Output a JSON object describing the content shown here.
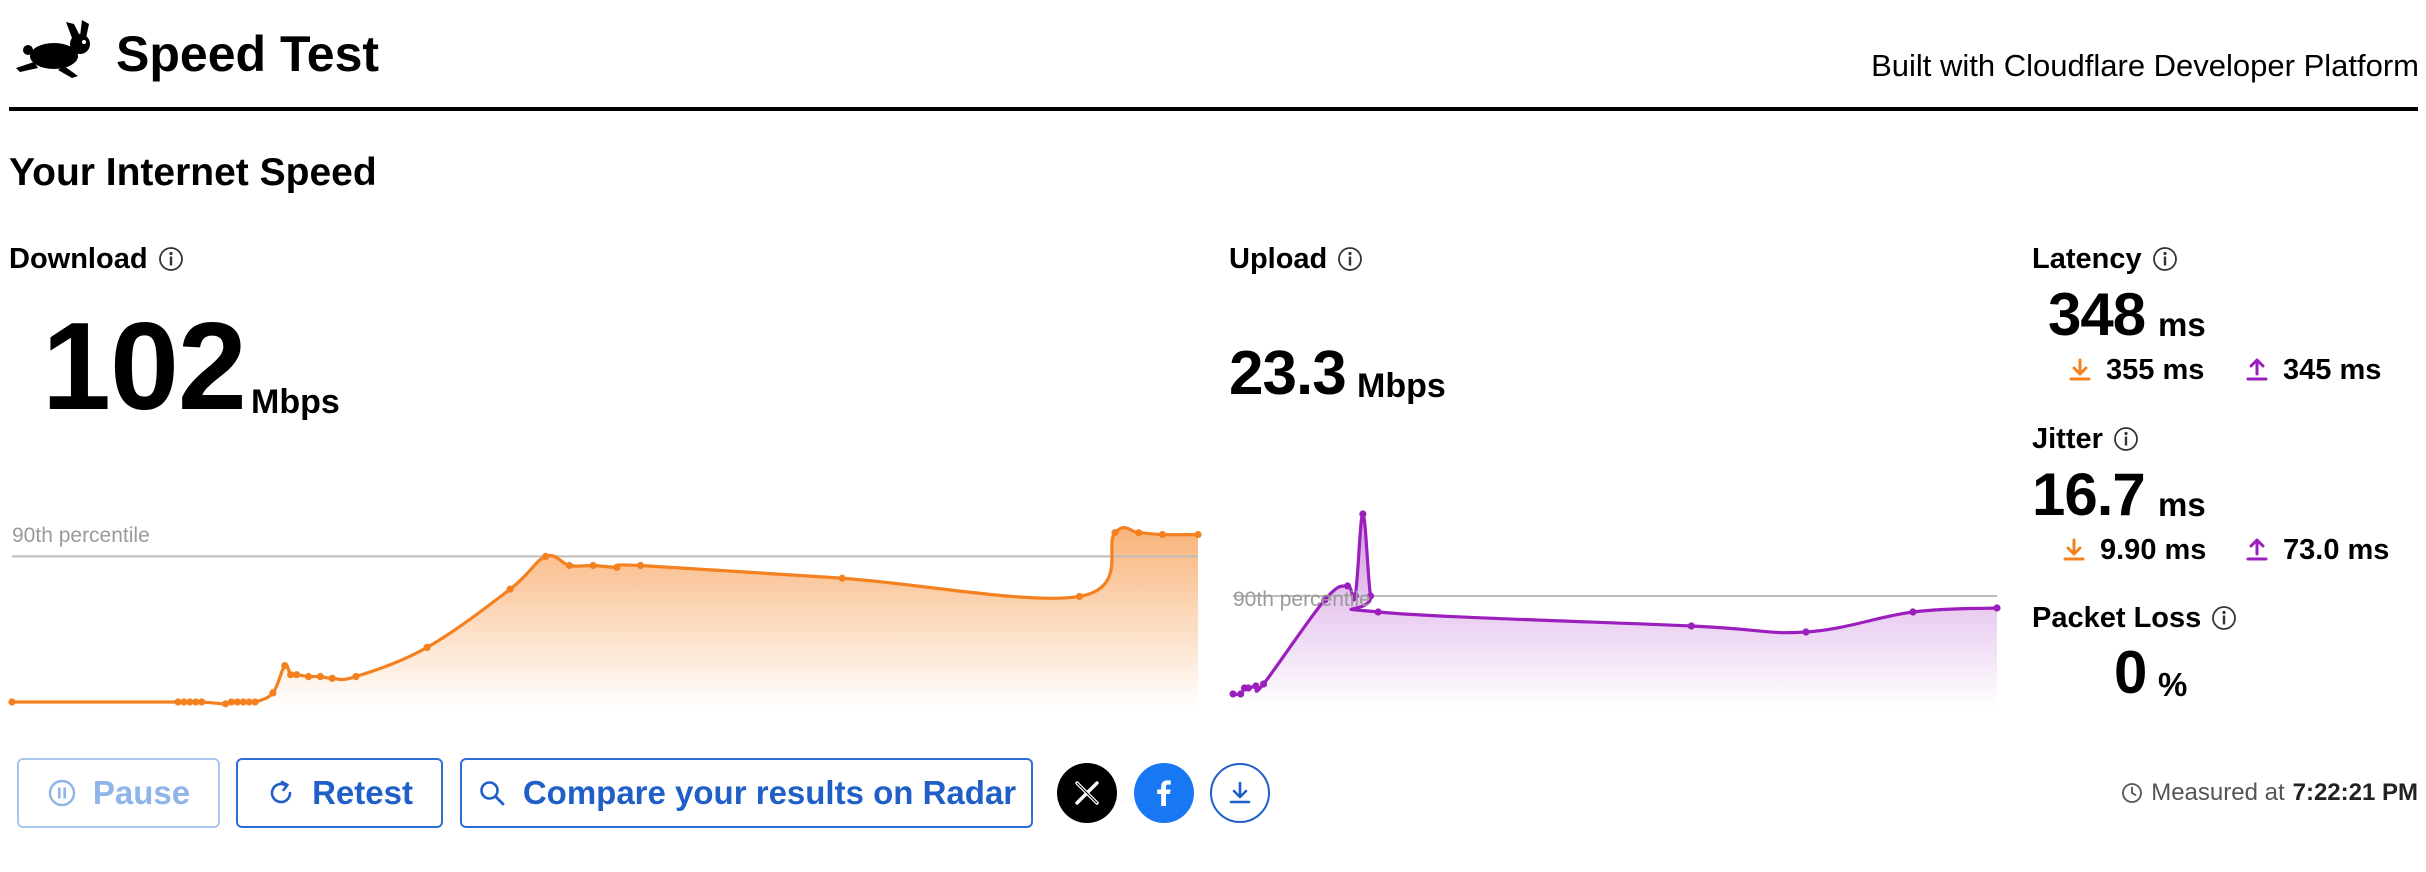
{
  "header": {
    "logo_icon": "running-rabbit-icon",
    "title": "Speed Test",
    "built_with": "Built with Cloudflare Developer Platform"
  },
  "section_title": "Your Internet Speed",
  "download": {
    "label": "Download",
    "value": "102",
    "unit": "Mbps",
    "percentile_label": "90th percentile",
    "color": "#f48120"
  },
  "upload": {
    "label": "Upload",
    "value": "23.3",
    "unit": "Mbps",
    "percentile_label": "90th percentile",
    "color": "#9b1fbd"
  },
  "latency": {
    "label": "Latency",
    "value": "348",
    "unit": "ms",
    "down": "355 ms",
    "up": "345 ms"
  },
  "jitter": {
    "label": "Jitter",
    "value": "16.7",
    "unit": "ms",
    "down": "9.90 ms",
    "up": "73.0 ms"
  },
  "packet_loss": {
    "label": "Packet Loss",
    "value": "0",
    "unit": "%"
  },
  "actions": {
    "pause": "Pause",
    "retest": "Retest",
    "compare": "Compare your results on Radar",
    "share_x_icon": "x-logo-icon",
    "share_facebook_icon": "facebook-icon",
    "download_icon": "download-icon"
  },
  "measured": {
    "label": "Measured at",
    "time": "7:22:21 PM"
  },
  "chart_data": [
    {
      "type": "area",
      "name": "download",
      "xlabel": "",
      "ylabel": "",
      "xlim": [
        0,
        1
      ],
      "ylim": [
        0,
        1
      ],
      "grid": false,
      "reference_line": {
        "label": "90th percentile",
        "y": 0.8
      },
      "series": [
        {
          "x": [
            0.0,
            0.14,
            0.145,
            0.15,
            0.155,
            0.16,
            0.18,
            0.185,
            0.19,
            0.195,
            0.2,
            0.205,
            0.22,
            0.23,
            0.235,
            0.24,
            0.25,
            0.26,
            0.27,
            0.29,
            0.35,
            0.42,
            0.45,
            0.47,
            0.49,
            0.51,
            0.53,
            0.7,
            0.9,
            0.93,
            0.95,
            0.97,
            1.0
          ],
          "y": [
            0.0,
            0.0,
            0.0,
            0.0,
            0.0,
            0.0,
            -0.01,
            0.0,
            0.0,
            0.0,
            0.0,
            0.0,
            0.05,
            0.2,
            0.15,
            0.15,
            0.14,
            0.14,
            0.13,
            0.14,
            0.3,
            0.62,
            0.8,
            0.75,
            0.75,
            0.74,
            0.75,
            0.68,
            0.58,
            0.93,
            0.93,
            0.92,
            0.92
          ]
        }
      ]
    },
    {
      "type": "area",
      "name": "upload",
      "xlabel": "",
      "ylabel": "",
      "xlim": [
        0,
        1
      ],
      "ylim": [
        0,
        1
      ],
      "grid": false,
      "reference_line": {
        "label": "90th percentile",
        "y": 0.52
      },
      "series": [
        {
          "x": [
            0.0,
            0.01,
            0.015,
            0.02,
            0.03,
            0.04,
            0.12,
            0.15,
            0.16,
            0.17,
            0.18,
            0.19,
            0.6,
            0.75,
            0.89,
            1.0
          ],
          "y": [
            0.03,
            0.03,
            0.06,
            0.06,
            0.07,
            0.08,
            0.5,
            0.57,
            0.52,
            0.93,
            0.52,
            0.44,
            0.37,
            0.34,
            0.44,
            0.46
          ]
        }
      ]
    }
  ]
}
